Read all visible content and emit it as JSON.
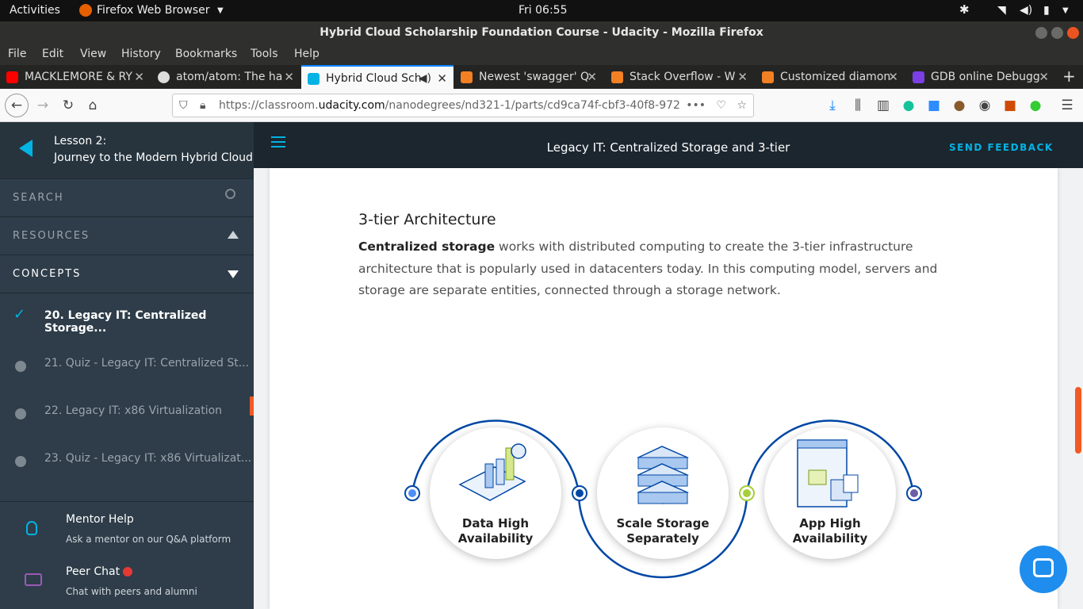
{
  "system": {
    "activities": "Activities",
    "app_name": "Firefox Web Browser",
    "clock": "Fri 06:55"
  },
  "window": {
    "title": "Hybrid Cloud Scholarship Foundation Course - Udacity - Mozilla Firefox"
  },
  "menu": [
    "File",
    "Edit",
    "View",
    "History",
    "Bookmarks",
    "Tools",
    "Help"
  ],
  "tabs": [
    {
      "label": "MACKLEMORE & RY",
      "icon_color": "#ff0000"
    },
    {
      "label": "atom/atom: The ha",
      "icon_color": "#dddddd"
    },
    {
      "label": "Hybrid Cloud Sch",
      "icon_color": "#02b3e4"
    },
    {
      "label": "Newest 'swagger' Q",
      "icon_color": "#f48024"
    },
    {
      "label": "Stack Overflow - W",
      "icon_color": "#f48024"
    },
    {
      "label": "Customized diamon",
      "icon_color": "#f48024"
    },
    {
      "label": "GDB online Debugg",
      "icon_color": "#7b3fe4"
    }
  ],
  "url": {
    "prefix": "https://classroom.",
    "domain": "udacity.com",
    "rest": "/nanodegrees/nd321-1/parts/cd9ca74f-cbf3-40f8-972"
  },
  "sidebar": {
    "lesson_num": "Lesson 2:",
    "lesson_title": "Journey to the Modern Hybrid Cloud",
    "search": "SEARCH",
    "resources": "RESOURCES",
    "concepts": "CONCEPTS",
    "items": [
      {
        "label": "20. Legacy IT: Centralized Storage...",
        "done": true
      },
      {
        "label": "21. Quiz - Legacy IT: Centralized St..."
      },
      {
        "label": "22. Legacy IT: x86 Virtualization"
      },
      {
        "label": "23. Quiz - Legacy IT: x86 Virtualizat..."
      }
    ],
    "mentor_title": "Mentor Help",
    "mentor_sub": "Ask a mentor on our Q&A platform",
    "peer_title": "Peer Chat",
    "peer_sub": "Chat with peers and alumni"
  },
  "header": {
    "title": "Legacy IT: Centralized Storage and 3-tier",
    "feedback": "SEND FEEDBACK"
  },
  "article": {
    "heading": "3-tier Architecture",
    "bold": "Centralized storage",
    "body": " works with distributed computing to create the 3-tier infrastructure architecture that is popularly used in datacenters today. In this computing model, servers and storage are separate entities, connected through a storage network."
  },
  "diagram": {
    "items": [
      {
        "line1": "Data High",
        "line2": "Availability"
      },
      {
        "line1": "Scale Storage",
        "line2": "Separately"
      },
      {
        "line1": "App High",
        "line2": "Availability"
      }
    ],
    "colors": {
      "blue": "#0047a5",
      "light_blue": "#4f8ef7",
      "green": "#a6ce39",
      "purple": "#6b5fa8"
    }
  }
}
